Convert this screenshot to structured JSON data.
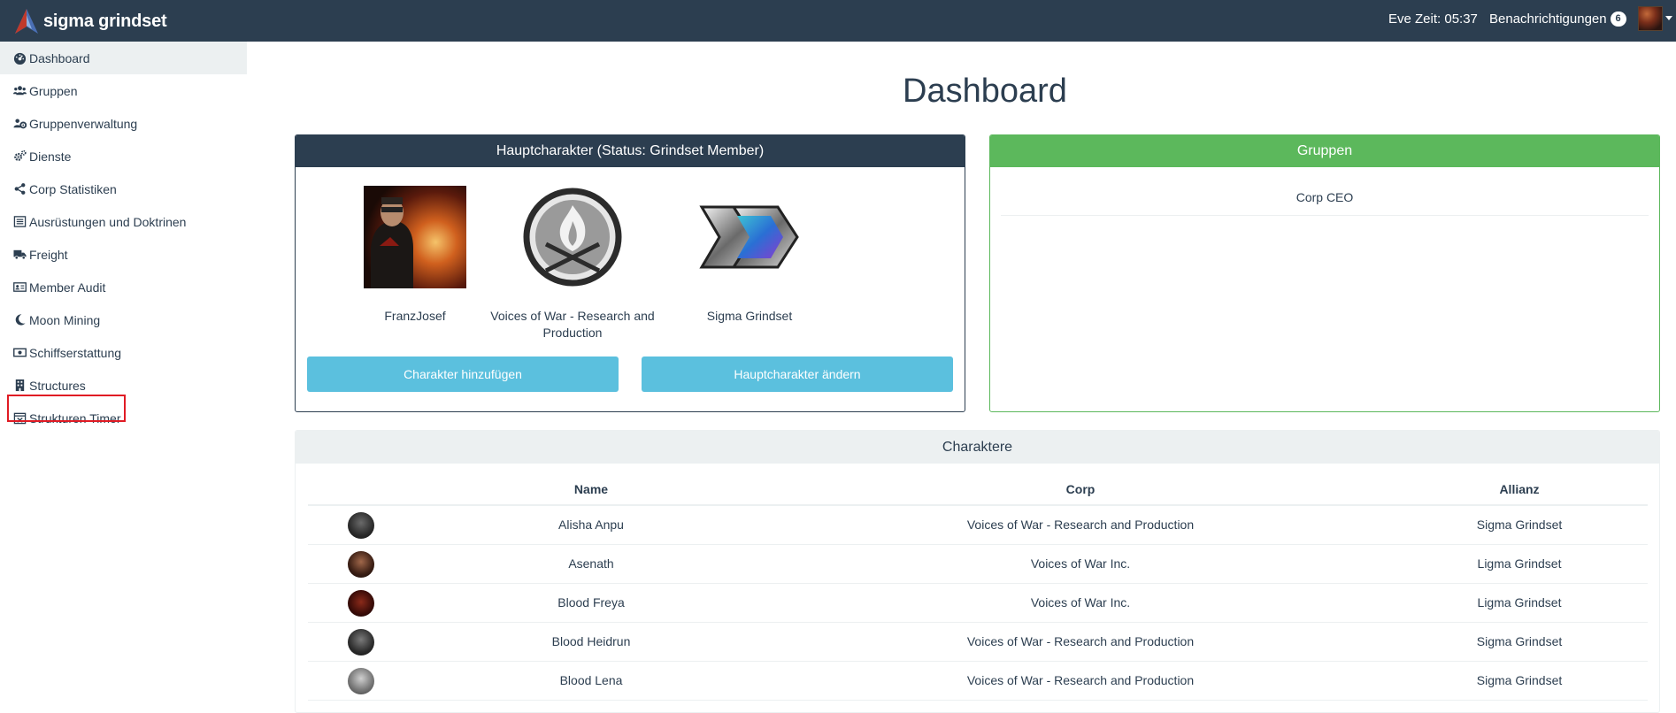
{
  "navbar": {
    "brand": "sigma grindset",
    "eve_time": "Eve Zeit: 05:37",
    "notifications_label": "Benachrichtigungen",
    "notifications_count": "6"
  },
  "sidebar": {
    "items": [
      {
        "label": "Dashboard",
        "icon": "tachometer-icon",
        "active": true
      },
      {
        "label": "Gruppen",
        "icon": "users-icon"
      },
      {
        "label": "Gruppenverwaltung",
        "icon": "users-cog-icon"
      },
      {
        "label": "Dienste",
        "icon": "cogs-icon"
      },
      {
        "label": "Corp Statistiken",
        "icon": "share-icon"
      },
      {
        "label": "Ausrüstungen und Doktrinen",
        "icon": "list-icon"
      },
      {
        "label": "Freight",
        "icon": "truck-icon"
      },
      {
        "label": "Member Audit",
        "icon": "id-card-icon"
      },
      {
        "label": "Moon Mining",
        "icon": "moon-icon"
      },
      {
        "label": "Schiffserstattung",
        "icon": "money-bill-icon",
        "highlighted": true
      },
      {
        "label": "Structures",
        "icon": "building-icon"
      },
      {
        "label": "Strukturen Timer",
        "icon": "calendar-times-icon"
      }
    ]
  },
  "main": {
    "title": "Dashboard",
    "main_character_panel": {
      "title": "Hauptcharakter (Status: Grindset Member)",
      "character": "FranzJosef",
      "corporation": "Voices of War - Research and Production",
      "alliance": "Sigma Grindset",
      "add_button": "Charakter hinzufügen",
      "change_button": "Hauptcharakter ändern"
    },
    "groups_panel": {
      "title": "Gruppen",
      "groups": [
        "Corp CEO"
      ]
    },
    "characters_panel": {
      "title": "Charaktere",
      "columns": [
        "Name",
        "Corp",
        "Allianz"
      ],
      "rows": [
        {
          "name": "Alisha Anpu",
          "corp": "Voices of War - Research and Production",
          "alliance": "Sigma Grindset"
        },
        {
          "name": "Asenath",
          "corp": "Voices of War Inc.",
          "alliance": "Ligma Grindset"
        },
        {
          "name": "Blood Freya",
          "corp": "Voices of War Inc.",
          "alliance": "Ligma Grindset"
        },
        {
          "name": "Blood Heidrun",
          "corp": "Voices of War - Research and Production",
          "alliance": "Sigma Grindset"
        },
        {
          "name": "Blood Lena",
          "corp": "Voices of War - Research and Production",
          "alliance": "Sigma Grindset"
        }
      ]
    }
  },
  "colors": {
    "navbar": "#2c3e50",
    "groups_accent": "#5cb85c",
    "button_info": "#5bc0de",
    "highlight": "#e01b24"
  }
}
